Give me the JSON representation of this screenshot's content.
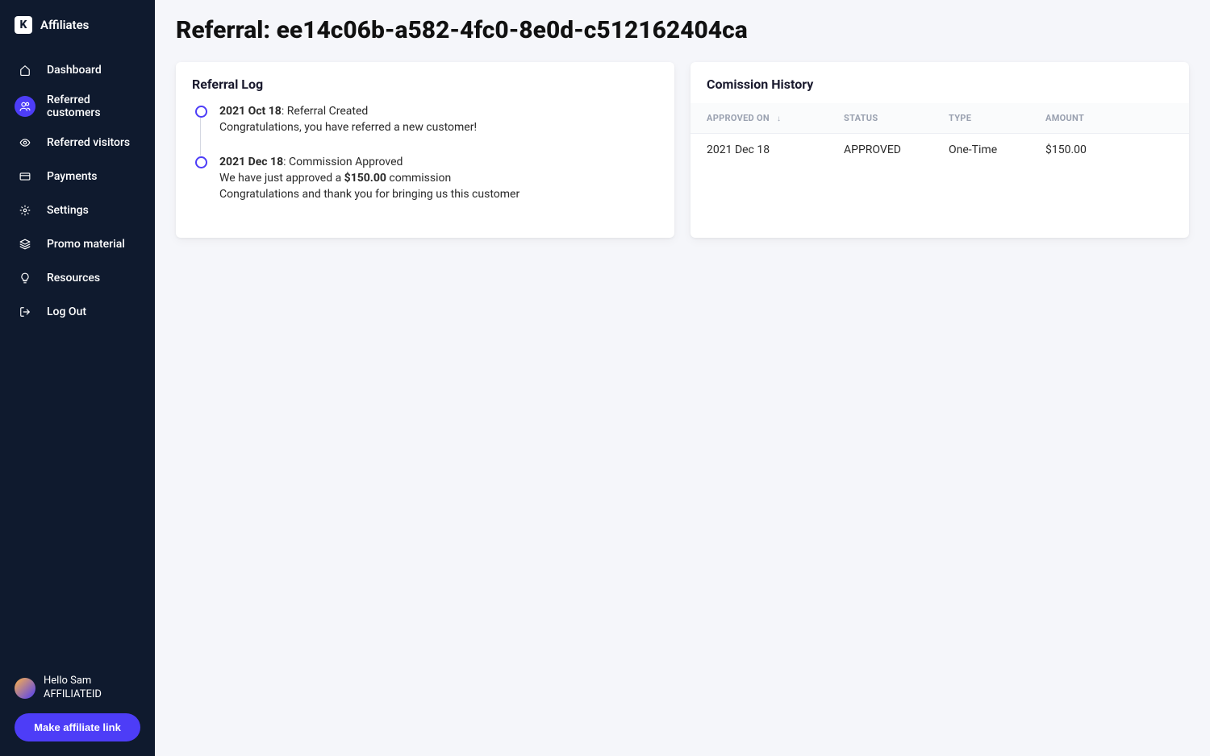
{
  "brand": {
    "name": "Affiliates",
    "logo_letter": "K"
  },
  "sidebar": {
    "items": [
      {
        "label": "Dashboard",
        "icon": "home-icon",
        "active": false
      },
      {
        "label": "Referred customers",
        "icon": "users-icon",
        "active": true
      },
      {
        "label": "Referred visitors",
        "icon": "eye-icon",
        "active": false
      },
      {
        "label": "Payments",
        "icon": "card-icon",
        "active": false
      },
      {
        "label": "Settings",
        "icon": "gear-icon",
        "active": false
      },
      {
        "label": "Promo material",
        "icon": "layers-icon",
        "active": false
      },
      {
        "label": "Resources",
        "icon": "bulb-icon",
        "active": false
      },
      {
        "label": "Log Out",
        "icon": "logout-icon",
        "active": false
      }
    ],
    "user_greeting": "Hello Sam",
    "user_id": "AFFILIATEID",
    "make_link_label": "Make affiliate link"
  },
  "page": {
    "title": "Referral: ee14c06b-a582-4fc0-8e0d-c512162404ca"
  },
  "referral_log": {
    "heading": "Referral Log",
    "entries": [
      {
        "date": "2021 Oct 18",
        "title": "Referral Created",
        "lines": [
          "Congratulations, you have referred a new customer!"
        ]
      },
      {
        "date": "2021 Dec 18",
        "title": "Commission Approved",
        "lines_html": [
          {
            "prefix": "We have just approved a ",
            "bold": "$150.00",
            "suffix": " commission"
          },
          {
            "prefix": "Congratulations and thank you for bringing us this customer",
            "bold": "",
            "suffix": ""
          }
        ]
      }
    ]
  },
  "commission_history": {
    "heading": "Comission History",
    "columns": {
      "approved_on": "APPROVED ON",
      "status": "STATUS",
      "type": "TYPE",
      "amount": "AMOUNT"
    },
    "rows": [
      {
        "approved_on": "2021 Dec 18",
        "status": "APPROVED",
        "type": "One-Time",
        "amount": "$150.00"
      }
    ]
  }
}
